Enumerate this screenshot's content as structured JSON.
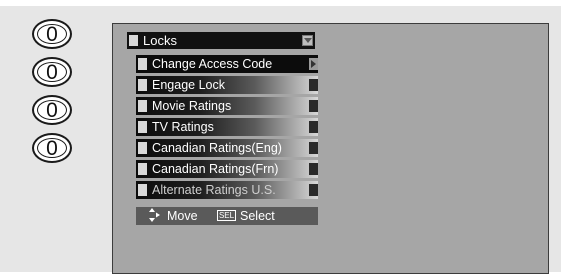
{
  "remote": {
    "buttons": [
      "0",
      "0",
      "0",
      "0"
    ]
  },
  "menu": {
    "title": "Locks",
    "items": [
      {
        "label": "Change Access Code",
        "selected": true
      },
      {
        "label": "Engage Lock",
        "selected": false
      },
      {
        "label": "Movie Ratings",
        "selected": false
      },
      {
        "label": "TV Ratings",
        "selected": false
      },
      {
        "label": "Canadian Ratings(Eng)",
        "selected": false
      },
      {
        "label": "Canadian Ratings(Frn)",
        "selected": false
      },
      {
        "label": "Alternate Ratings U.S.",
        "selected": false
      }
    ]
  },
  "help": {
    "move_label": "Move",
    "sel_icon_text": "SEL",
    "select_label": "Select"
  },
  "icons": {
    "move": "updown-move-icon",
    "sel": "sel-key-icon",
    "dropdown": "dropdown-arrow-icon",
    "submenu": "right-arrow-icon"
  },
  "colors": {
    "screen_bg": "#a6a6a6",
    "frame_bg": "#e6e6e6",
    "menu_dark": "#0c0c0c",
    "help_bar": "#5a5a5a"
  }
}
